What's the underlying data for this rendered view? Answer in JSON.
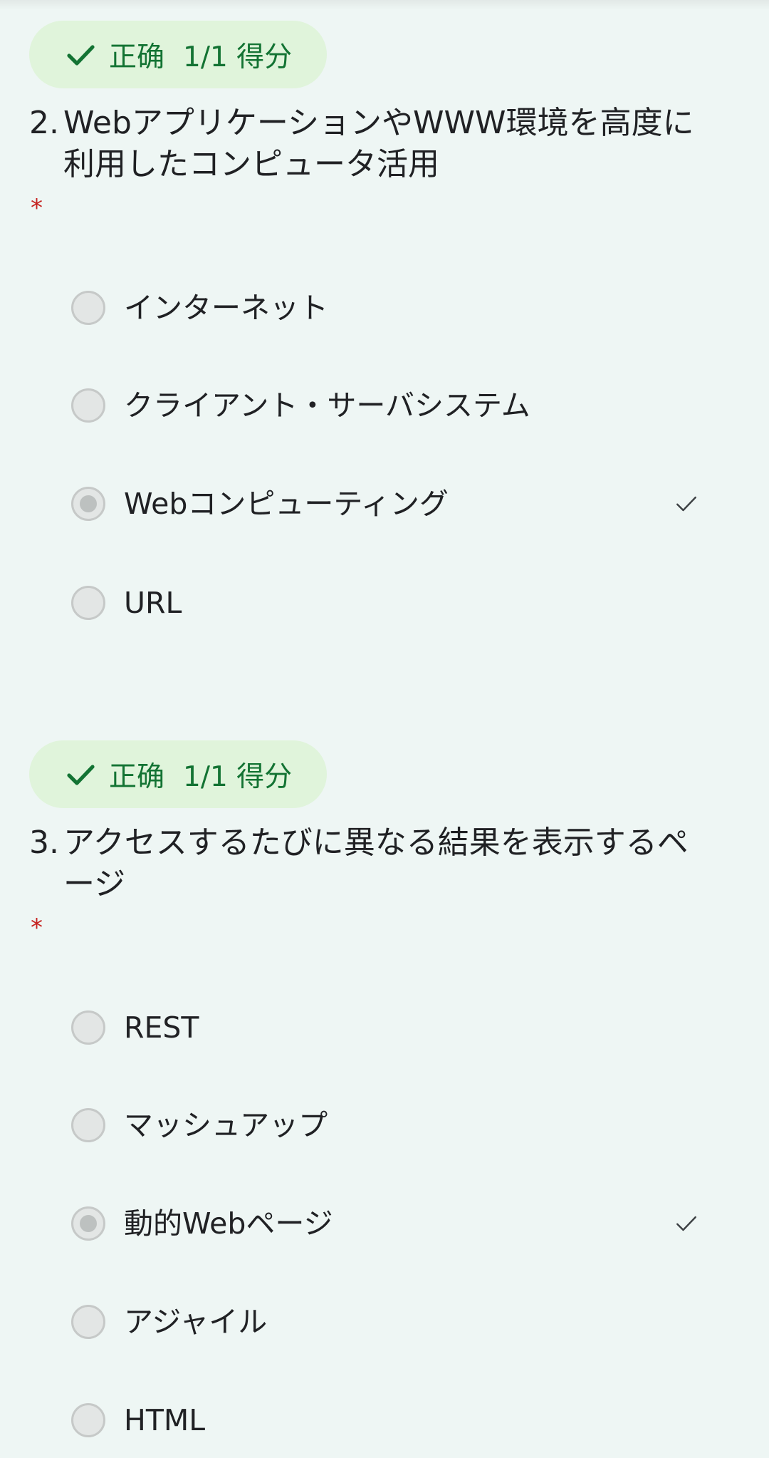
{
  "questions": [
    {
      "score_status": "正确",
      "score_value": "1/1 得分",
      "number": "2.",
      "title": "WebアプリケーションやWWW環境を高度に利用したコンピュータ活用",
      "required_mark": "*",
      "options": [
        {
          "label": "インターネット",
          "selected": false,
          "correct": false
        },
        {
          "label": "クライアント・サーバシステム",
          "selected": false,
          "correct": false
        },
        {
          "label": "Webコンピューティング",
          "selected": true,
          "correct": true
        },
        {
          "label": "URL",
          "selected": false,
          "correct": false
        }
      ]
    },
    {
      "score_status": "正确",
      "score_value": "1/1 得分",
      "number": "3.",
      "title": "アクセスするたびに異なる結果を表示するページ",
      "required_mark": "*",
      "options": [
        {
          "label": "REST",
          "selected": false,
          "correct": false
        },
        {
          "label": "マッシュアップ",
          "selected": false,
          "correct": false
        },
        {
          "label": "動的Webページ",
          "selected": true,
          "correct": true
        },
        {
          "label": "アジャイル",
          "selected": false,
          "correct": false
        },
        {
          "label": "HTML",
          "selected": false,
          "correct": false
        }
      ]
    }
  ],
  "icons": {
    "score_check": "check-icon",
    "correct_answer": "checkmark-icon",
    "radio": "radio-button"
  },
  "colors": {
    "background": "#eef6f4",
    "score_pill_bg": "#e0f4db",
    "score_text": "#137333",
    "required": "#c5221f",
    "radio_fill": "#e3e6e5",
    "radio_dot": "#bdc1c0"
  }
}
